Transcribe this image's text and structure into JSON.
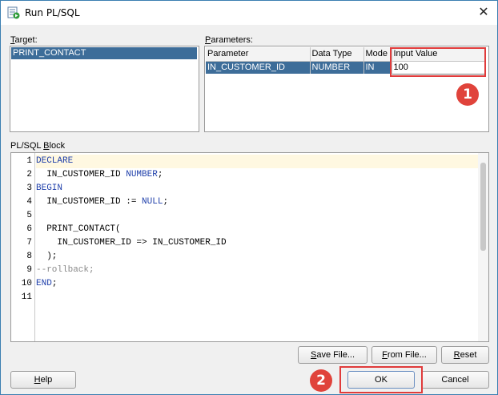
{
  "window": {
    "title": "Run PL/SQL",
    "close_glyph": "✕"
  },
  "target": {
    "label_first": "T",
    "label_rest": "arget:",
    "items": [
      "PRINT_CONTACT"
    ]
  },
  "parameters": {
    "label_first": "P",
    "label_rest": "arameters:",
    "columns": [
      "Parameter",
      "Data Type",
      "Mode",
      "Input Value"
    ],
    "rows": [
      {
        "parameter": "IN_CUSTOMER_ID",
        "data_type": "NUMBER",
        "mode": "IN",
        "input_value": "100"
      }
    ]
  },
  "plsql_block": {
    "label_pre": "PL/SQL ",
    "label_first": "B",
    "label_rest": "lock",
    "line_numbers": [
      "1",
      "2",
      "3",
      "4",
      "5",
      "6",
      "7",
      "8",
      "9",
      "10",
      "11"
    ],
    "lines": [
      [
        {
          "t": "DECLARE",
          "c": "kw"
        }
      ],
      [
        {
          "t": "  IN_CUSTOMER_ID ",
          "c": ""
        },
        {
          "t": "NUMBER",
          "c": "kw"
        },
        {
          "t": ";",
          "c": ""
        }
      ],
      [
        {
          "t": "BEGIN",
          "c": "kw"
        }
      ],
      [
        {
          "t": "  IN_CUSTOMER_ID := ",
          "c": ""
        },
        {
          "t": "NULL",
          "c": "kw"
        },
        {
          "t": ";",
          "c": ""
        }
      ],
      [],
      [
        {
          "t": "  PRINT_CONTACT(",
          "c": ""
        }
      ],
      [
        {
          "t": "    IN_CUSTOMER_ID => IN_CUSTOMER_ID",
          "c": ""
        }
      ],
      [
        {
          "t": "  );",
          "c": ""
        }
      ],
      [
        {
          "t": "--rollback;",
          "c": "cm"
        }
      ],
      [
        {
          "t": "END",
          "c": "kw"
        },
        {
          "t": ";",
          "c": ""
        }
      ],
      []
    ]
  },
  "buttons": {
    "save_file_first": "S",
    "save_file_rest": "ave File...",
    "from_file_first": "F",
    "from_file_rest": "rom File...",
    "reset_first": "R",
    "reset_rest": "eset",
    "help_first": "H",
    "help_rest": "elp",
    "ok": "OK",
    "cancel": "Cancel"
  },
  "annotations": {
    "marker_1": "1",
    "marker_2": "2",
    "highlight_color": "#e03b3b"
  },
  "colors": {
    "selection": "#3d6d99",
    "keyword": "#1f3faa",
    "comment": "#8a8a8a"
  }
}
